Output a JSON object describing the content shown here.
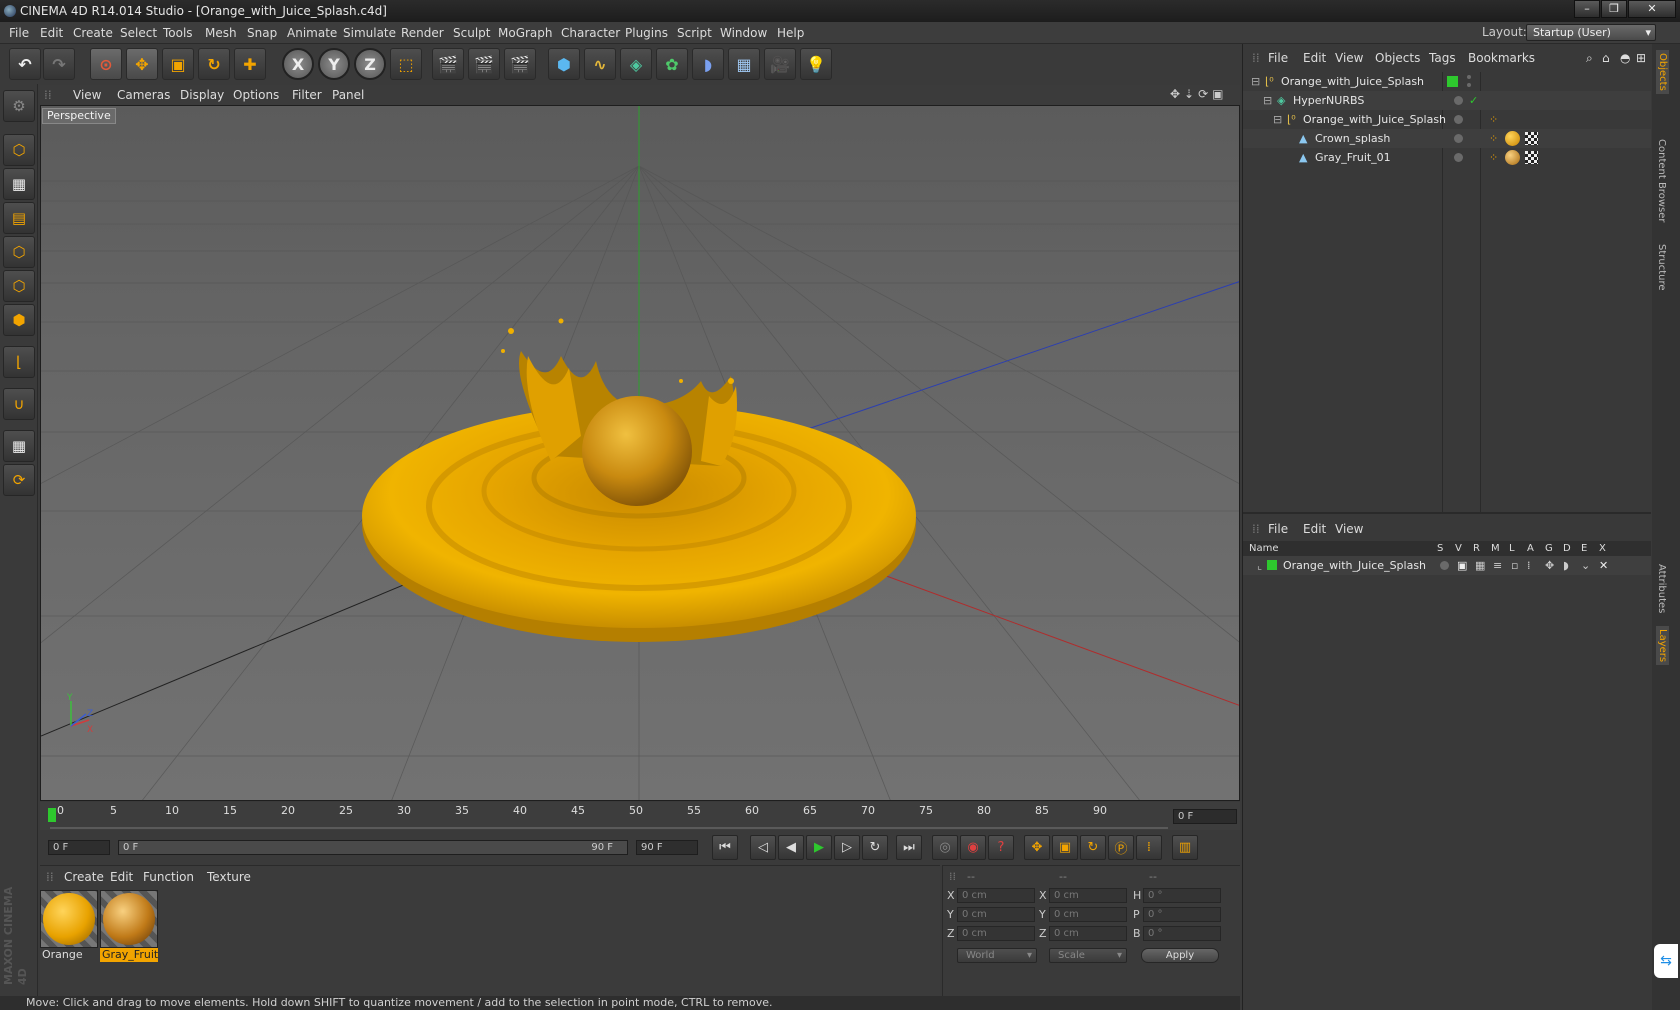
{
  "window": {
    "title": "CINEMA 4D R14.014 Studio - [Orange_with_Juice_Splash.c4d]"
  },
  "menu": [
    "File",
    "Edit",
    "Create",
    "Select",
    "Tools",
    "Mesh",
    "Snap",
    "Animate",
    "Simulate",
    "Render",
    "Sculpt",
    "MoGraph",
    "Character",
    "Plugins",
    "Script",
    "Window",
    "Help"
  ],
  "layout": {
    "label": "Layout:",
    "value": "Startup (User)"
  },
  "viewport": {
    "menu": [
      "View",
      "Cameras",
      "Display",
      "Options",
      "Filter",
      "Panel"
    ],
    "label": "Perspective",
    "axis_labels": {
      "y": "Y",
      "x": "X",
      "z": "Z"
    }
  },
  "timeline": {
    "ticks": [
      "0",
      "5",
      "10",
      "15",
      "20",
      "25",
      "30",
      "35",
      "40",
      "45",
      "50",
      "55",
      "60",
      "65",
      "70",
      "75",
      "80",
      "85",
      "90"
    ],
    "current_frame": "0 F"
  },
  "transport": {
    "start": "0 F",
    "range_start": "0 F",
    "range_end": "90 F",
    "end": "90 F"
  },
  "materials": {
    "menu": [
      "Create",
      "Edit",
      "Function",
      "Texture"
    ],
    "items": [
      {
        "name": "Orange",
        "selected": false
      },
      {
        "name": "Gray_Fruit",
        "selected": true
      }
    ]
  },
  "coordinates": {
    "header": [
      "--",
      "--",
      "--"
    ],
    "rows": [
      {
        "a": "X",
        "av": "0 cm",
        "b": "X",
        "bv": "0 cm",
        "c": "H",
        "cv": "0 °"
      },
      {
        "a": "Y",
        "av": "0 cm",
        "b": "Y",
        "bv": "0 cm",
        "c": "P",
        "cv": "0 °"
      },
      {
        "a": "Z",
        "av": "0 cm",
        "b": "Z",
        "bv": "0 cm",
        "c": "B",
        "cv": "0 °"
      }
    ],
    "mode": "World",
    "size_mode": "Scale",
    "apply": "Apply"
  },
  "status": "Move: Click and drag to move elements. Hold down SHIFT to quantize movement / add to the selection in point mode, CTRL to remove.",
  "object_manager": {
    "menu": [
      "File",
      "Edit",
      "View",
      "Objects",
      "Tags",
      "Bookmarks"
    ],
    "objects": [
      {
        "name": "Orange_with_Juice_Splash"
      },
      {
        "name": "HyperNURBS"
      },
      {
        "name": "Orange_with_Juice_Splash"
      },
      {
        "name": "Crown_splash"
      },
      {
        "name": "Gray_Fruit_01"
      }
    ]
  },
  "layer_manager": {
    "menu": [
      "File",
      "Edit",
      "View"
    ],
    "columns": [
      "Name",
      "S",
      "V",
      "R",
      "M",
      "L",
      "A",
      "G",
      "D",
      "E",
      "X"
    ],
    "layers": [
      {
        "name": "Orange_with_Juice_Splash"
      }
    ]
  },
  "side_tabs": [
    "Objects",
    "Content Browser",
    "Structure",
    "Attributes",
    "Layers"
  ],
  "colors": {
    "accent_orange": "#f2a400",
    "layer_green": "#2ec82e"
  },
  "maxon_logo": "MAXON CINEMA 4D"
}
